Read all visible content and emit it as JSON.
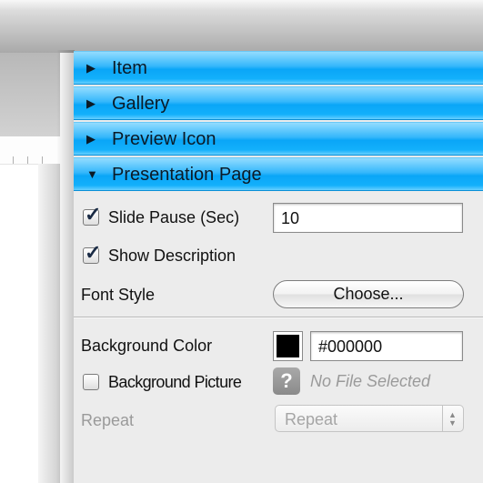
{
  "sections": [
    {
      "label": "Item",
      "expanded": false
    },
    {
      "label": "Gallery",
      "expanded": false
    },
    {
      "label": "Preview Icon",
      "expanded": false
    },
    {
      "label": "Presentation Page",
      "expanded": true
    }
  ],
  "icons": {
    "collapsed": "▶",
    "expanded": "▼",
    "check": "✓",
    "question": "?",
    "stepper_up": "▲",
    "stepper_down": "▼"
  },
  "presentation": {
    "slide_pause": {
      "label": "Slide Pause (Sec)",
      "checked": true,
      "value": "10"
    },
    "show_description": {
      "label": "Show Description",
      "checked": true
    },
    "font_style": {
      "label": "Font Style",
      "button": "Choose..."
    },
    "background_color": {
      "label": "Background Color",
      "swatch_color": "#000000",
      "value": "#000000"
    },
    "background_picture": {
      "label": "Background Picture",
      "checked": false,
      "file": "No File Selected"
    },
    "repeat": {
      "label": "Repeat",
      "value": "Repeat",
      "enabled": false
    }
  },
  "colors": {
    "header_blue": "#0aa6f7",
    "panel_bg": "#ececec"
  }
}
